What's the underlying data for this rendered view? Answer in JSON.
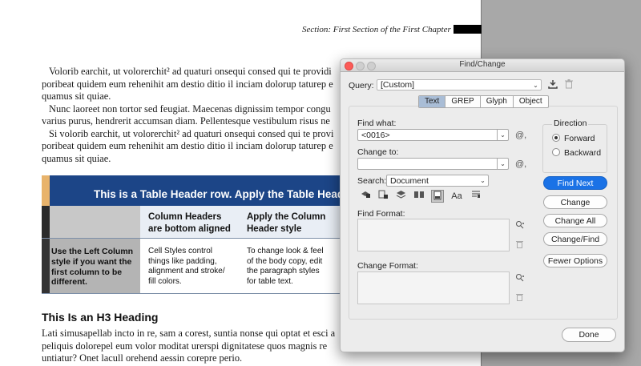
{
  "document": {
    "running_header": "Section: First Section of the First Chapter",
    "paragraphs": [
      "Volorib earchit, ut volorerchit² ad quaturi onsequi consed qui te providi",
      "poribeat quidem eum rehenihit am destio ditio il inciam dolorup taturep e",
      "quamus sit quiae.",
      "Nunc laoreet non tortor sed feugiat. Maecenas dignissim tempor congu",
      "varius purus, hendrerit accumsan diam. Pellentesque vestibulum risus ne",
      "Si volorib earchit, ut volorerchit² ad quaturi onsequi consed qui te provi",
      "poribeat quidem eum rehenihit am destio ditio il inciam dolorup taturep e",
      "quamus sit quiae."
    ],
    "table": {
      "header_row": "This is a Table Header row. Apply the Table Header",
      "column_headers": [
        [
          "Column Headers",
          "are bottom aligned"
        ],
        [
          "Apply the Column",
          "Header style"
        ]
      ],
      "left_column": [
        "Use the Left Column",
        "style if you want the",
        "first column to be",
        "different."
      ],
      "body_cells": [
        [
          "Cell Styles control",
          "things like padding,",
          "alignment and stroke/",
          "fill colors."
        ],
        [
          "To change look & feel",
          "of the body copy, edit",
          "the paragraph styles",
          "for table text."
        ]
      ]
    },
    "h3": "This Is an H3 Heading",
    "closing_paragraph": [
      "Lati simusapellab incto in re, sam a corest, suntia nonse qui optat et esci a",
      "peliquis dolorepel eum volor moditat urerspi dignitatese quos magnis re",
      "untiatur? Onet lacull orehend aessin corepre perio."
    ]
  },
  "dialog": {
    "title": "Find/Change",
    "query_label": "Query:",
    "query_value": "[Custom]",
    "tabs": [
      "Text",
      "GREP",
      "Glyph",
      "Object"
    ],
    "active_tab": "Text",
    "find_what_label": "Find what:",
    "find_what_value": "<0016>",
    "change_to_label": "Change to:",
    "change_to_value": "",
    "search_label": "Search:",
    "search_value": "Document",
    "find_format_label": "Find Format:",
    "change_format_label": "Change Format:",
    "direction": {
      "title": "Direction",
      "options": [
        "Forward",
        "Backward"
      ],
      "selected": "Forward"
    },
    "buttons": {
      "find_next": "Find Next",
      "change": "Change",
      "change_all": "Change All",
      "change_find": "Change/Find",
      "fewer_options": "Fewer Options",
      "done": "Done"
    },
    "search_options_icons": [
      "include-locked-layers-icon",
      "include-locked-stories-icon",
      "include-hidden-layers-icon",
      "include-master-pages-icon",
      "include-footnotes-icon",
      "case-sensitive-icon",
      "whole-word-icon"
    ],
    "colors": {
      "primary_button": "#1a72e6",
      "table_header": "#1c4587",
      "close_button": "#fc5b57"
    }
  }
}
